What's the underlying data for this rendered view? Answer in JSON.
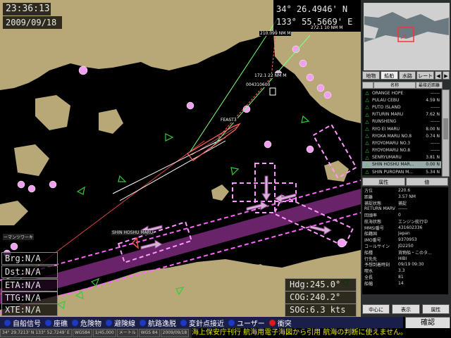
{
  "clock": {
    "time": "23:36:13",
    "date": "2009/09/18"
  },
  "position": {
    "lat": "34° 26.4946' N",
    "lon": "133° 55.5669' E"
  },
  "nav_left": {
    "brg": "Brg:N/A",
    "dst": "Dst:N/A",
    "eta": "ETA:N/A",
    "ttg": "TTG:N/A",
    "xte": "XTE:N/A"
  },
  "nav_right": {
    "hdg": "Hdg:245.0°",
    "cog": "COG:240.2°",
    "sog": "SOG:6.3 kts"
  },
  "map_labels": {
    "l1": "210.099 NM M",
    "l2": "272.1 10 NM M",
    "l3": "172.1 22 NM M",
    "l4": "004310600",
    "l5": "FEAST3",
    "l6": "SHIN HOSHU MARU",
    "l7": "ーマンツワーキ"
  },
  "tabs": [
    "地物",
    "船舶",
    "水路",
    "レート"
  ],
  "tab_arrows": [
    "◀",
    "▶"
  ],
  "list_header": {
    "col1": "名称",
    "col2": "最接近距離"
  },
  "ships": [
    {
      "name": "ORANGE HOPE",
      "dist": "------"
    },
    {
      "name": "PULAU CEBU",
      "dist": "4.59 N"
    },
    {
      "name": "PUTO ISLAND",
      "dist": "------"
    },
    {
      "name": "RITURIN MARU",
      "dist": "7.62 N"
    },
    {
      "name": "RUNSHENG",
      "dist": "------"
    },
    {
      "name": "RYO EI MARU",
      "dist": "8.00 N"
    },
    {
      "name": "RYOKA MARU NO.8",
      "dist": "0.74 N"
    },
    {
      "name": "RYOYOMARU NO.3",
      "dist": "------"
    },
    {
      "name": "RYOYOMARU NO.8",
      "dist": "------"
    },
    {
      "name": "SENRYUMARU",
      "dist": "3.81 N"
    },
    {
      "name": "SHIN HOSHU MAR...",
      "dist": "0.00 N"
    },
    {
      "name": "SHIN PUROPAN M...",
      "dist": "5.34 N"
    }
  ],
  "attr_header": {
    "col1": "属性",
    "col2": "値"
  },
  "attributes": [
    {
      "k": "方位",
      "v": "220.6"
    },
    {
      "k": "距離",
      "v": "3.57 NM"
    },
    {
      "k": "捕捉状態",
      "v": "捕捉"
    },
    {
      "k": "RETURN MARV",
      "v": "------"
    },
    {
      "k": "回頭率",
      "v": "0"
    },
    {
      "k": "航海状態",
      "v": "エンジン航行中"
    },
    {
      "k": "MMSI番号",
      "v": "431602336"
    },
    {
      "k": "船籍国",
      "v": "Japan"
    },
    {
      "k": "IMO番号",
      "v": "9370953"
    },
    {
      "k": "コールサイン",
      "v": "JD2250"
    },
    {
      "k": "船種",
      "v": "貨物船・このタ..."
    },
    {
      "k": "行先先",
      "v": "HIBI"
    },
    {
      "k": "予想到着時刻",
      "v": "09/19 09:30"
    },
    {
      "k": "喫水",
      "v": "3.3"
    },
    {
      "k": "全長",
      "v": "81"
    },
    {
      "k": "船幅",
      "v": "14"
    }
  ],
  "panel_buttons": [
    "中心に",
    "表示",
    "属性"
  ],
  "confirm": "確認",
  "legend": [
    {
      "label": "自船信号",
      "color": "#1d39c4"
    },
    {
      "label": "座礁",
      "color": "#1d39c4"
    },
    {
      "label": "危険物",
      "color": "#1d39c4"
    },
    {
      "label": "避険線",
      "color": "#1d39c4"
    },
    {
      "label": "航路逸脱",
      "color": "#1d39c4"
    },
    {
      "label": "変針点接近",
      "color": "#1d39c4"
    },
    {
      "label": "ユーザー",
      "color": "#1d39c4"
    },
    {
      "label": "衝突",
      "color": "#e01818"
    }
  ],
  "status": {
    "s1": "34° 29.7213' N 133° 52.7249' E",
    "s2": "WGS84",
    "s3": "1/45,000",
    "s4": "メートル",
    "s5": "WGS 84",
    "s6": "2009/09/18",
    "warning": "海上保安庁刊行 航海用電子海図から引用 航海の判断に使えません。"
  },
  "colors": {
    "land": "#b8a878",
    "water": "#000000",
    "lane": "#e05ce0",
    "route": "#e040e0"
  }
}
